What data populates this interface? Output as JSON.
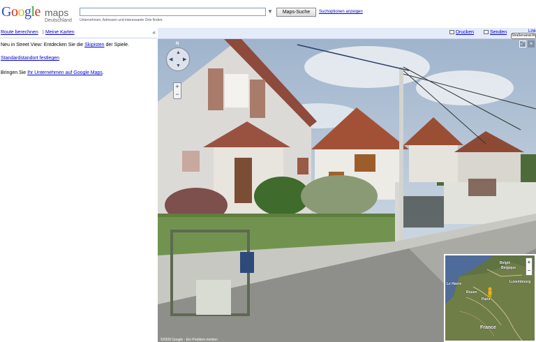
{
  "header": {
    "logo_letters": [
      "G",
      "o",
      "o",
      "g",
      "l",
      "e"
    ],
    "logo_colors": [
      "#1f4fd4",
      "#d62d20",
      "#f0b400",
      "#1f4fd4",
      "#2a9b2a",
      "#d62d20"
    ],
    "product": "maps",
    "country": "Deutschland",
    "search_value": "",
    "search_hint": "Unternehmen, Adressen und interessante Orte finden.",
    "search_button": "Maps-Suche",
    "search_options": "Suchoptionen anzeigen"
  },
  "left": {
    "link_directions": "Route berechnen",
    "link_separator": "|",
    "link_my_maps": "Meine Karten",
    "collapse": "«",
    "line1_prefix": "Neu in Street View: Entdecken Sie die ",
    "line1_link": "Skipisten",
    "line1_suffix": " der Spiele.",
    "line2_link": "Standardstandort festlegen",
    "line3_prefix": "Bringen Sie ",
    "line3_link": "Ihr Unternehmen auf Google Maps",
    "line3_suffix": "."
  },
  "toolbar": {
    "print": "Drucken",
    "send": "Senden",
    "link": "Link"
  },
  "streetview": {
    "label": "Straßenansicht",
    "compass_north": "N",
    "zoom_in": "+",
    "zoom_out": "−",
    "fullscreen": "⤢",
    "close": "×",
    "copyright": "©2009 Google - Ein Problem melden"
  },
  "inset_map": {
    "zoom_in": "+",
    "zoom_out": "−",
    "cities": [
      "België",
      "Belgique",
      "Le Havre",
      "Rouen",
      "Paris",
      "Luxembourg",
      "France"
    ],
    "country_label": "France"
  },
  "colors": {
    "link": "#0000cc",
    "toolbar_bg": "#e5ecf9",
    "sky": "#b9c6d6"
  }
}
